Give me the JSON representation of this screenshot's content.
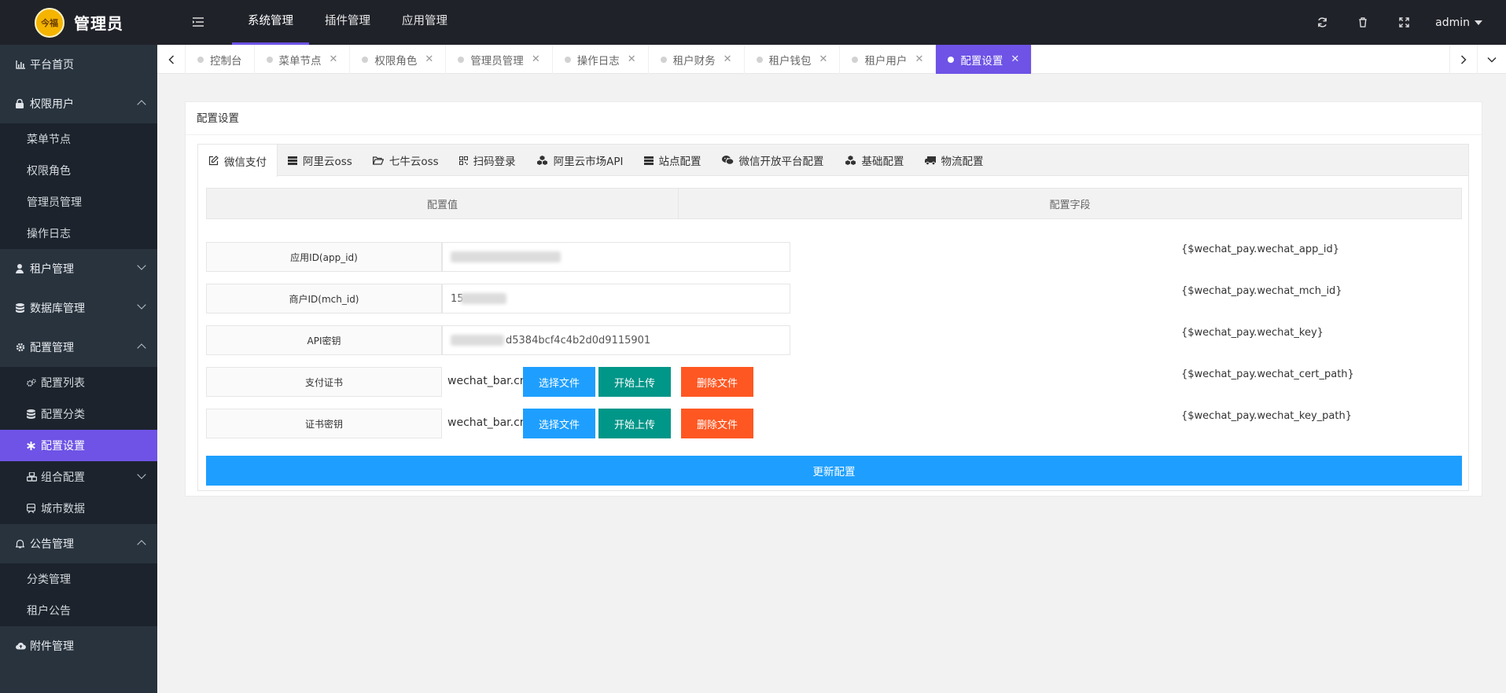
{
  "app": {
    "title": "管理员",
    "badge": "今福"
  },
  "topnav": [
    "系统管理",
    "插件管理",
    "应用管理"
  ],
  "user": {
    "name": "admin"
  },
  "sidebar": {
    "home": "平台首页",
    "auth": {
      "label": "权限用户",
      "items": [
        "菜单节点",
        "权限角色",
        "管理员管理",
        "操作日志"
      ]
    },
    "tenant": "租户管理",
    "db": "数据库管理",
    "config": {
      "label": "配置管理",
      "items": [
        "配置列表",
        "配置分类",
        "配置设置",
        "组合配置",
        "城市数据"
      ]
    },
    "notice": {
      "label": "公告管理",
      "items": [
        "分类管理",
        "租户公告"
      ]
    },
    "attach": "附件管理"
  },
  "tabs": [
    "控制台",
    "菜单节点",
    "权限角色",
    "管理员管理",
    "操作日志",
    "租户财务",
    "租户钱包",
    "租户用户",
    "配置设置"
  ],
  "panel": {
    "title": "配置设置",
    "tabs": [
      "微信支付",
      "阿里云oss",
      "七牛云oss",
      "扫码登录",
      "阿里云市场API",
      "站点配置",
      "微信开放平台配置",
      "基础配置",
      "物流配置"
    ],
    "col_value": "配置值",
    "col_field": "配置字段",
    "rows": [
      {
        "label": "应用ID(app_id)",
        "value": "",
        "field": "{$wechat_pay.wechat_app_id}"
      },
      {
        "label": "商户ID(mch_id)",
        "value": "15",
        "field": "{$wechat_pay.wechat_mch_id}"
      },
      {
        "label": "API密钥",
        "value": "d5384bcf4c4b2d0d9115901",
        "field": "{$wechat_pay.wechat_key}"
      },
      {
        "label": "支付证书",
        "filename": "wechat_bar.crt",
        "field": "{$wechat_pay.wechat_cert_path}"
      },
      {
        "label": "证书密钥",
        "filename": "wechat_bar.crt",
        "field": "{$wechat_pay.wechat_key_path}"
      }
    ],
    "btn_choose": "选择文件",
    "btn_upload": "开始上传",
    "btn_delete": "删除文件",
    "submit": "更新配置"
  },
  "colors": {
    "accent": "#6e53e6",
    "blue": "#1e9fff",
    "green": "#009688",
    "red": "#ff5722"
  }
}
